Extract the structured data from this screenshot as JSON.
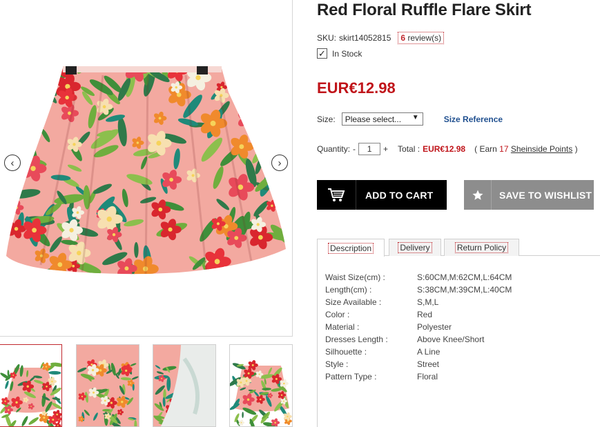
{
  "product": {
    "title": "Red Floral Ruffle Flare Skirt",
    "sku_label": "SKU:",
    "sku": "skirt14052815",
    "review_count": "6",
    "review_label": "review(s)",
    "stock": "In Stock",
    "price": "EUR€12.98"
  },
  "size": {
    "label": "Size:",
    "select_value": "Please select...",
    "reference_link": "Size Reference"
  },
  "quantity": {
    "label": "Quantity:",
    "minus": "-",
    "value": "1",
    "plus": "+",
    "total_label": "Total :",
    "total_value": "EUR€12.98",
    "earn_prefix": "( Earn",
    "earn_points": "17",
    "points_link": "Sheinside Points",
    "earn_suffix": ")"
  },
  "buttons": {
    "add_to_cart": "ADD TO CART",
    "save_to_wishlist": "SAVE TO WISHLIST",
    "cart_icon": "shopping-cart-icon",
    "wishlist_icon": "star-icon"
  },
  "gallery": {
    "prev_arrow": "‹",
    "next_arrow": "›",
    "thumbnail_count": 4,
    "active_thumbnail": 0
  },
  "tabs": [
    {
      "label": "Description"
    },
    {
      "label": "Delivery"
    },
    {
      "label": "Return Policy"
    }
  ],
  "specs": [
    {
      "key": "Waist Size(cm) :",
      "value": "S:60CM,M:62CM,L:64CM"
    },
    {
      "key": "Length(cm) :",
      "value": "S:38CM,M:39CM,L:40CM"
    },
    {
      "key": "Size Available :",
      "value": "S,M,L"
    },
    {
      "key": "Color :",
      "value": "Red"
    },
    {
      "key": "Material :",
      "value": "Polyester"
    },
    {
      "key": "Dresses Length :",
      "value": "Above Knee/Short"
    },
    {
      "key": "Silhouette :",
      "value": "A Line"
    },
    {
      "key": "Style :",
      "value": "Street"
    },
    {
      "key": "Pattern Type :",
      "value": "Floral"
    }
  ],
  "colors": {
    "price_red": "#c0141a",
    "link_blue": "#1f4f8f",
    "cart_button": "#000000",
    "wishlist_button": "#8d8d8d",
    "skirt_base": "#f3a9a0"
  }
}
